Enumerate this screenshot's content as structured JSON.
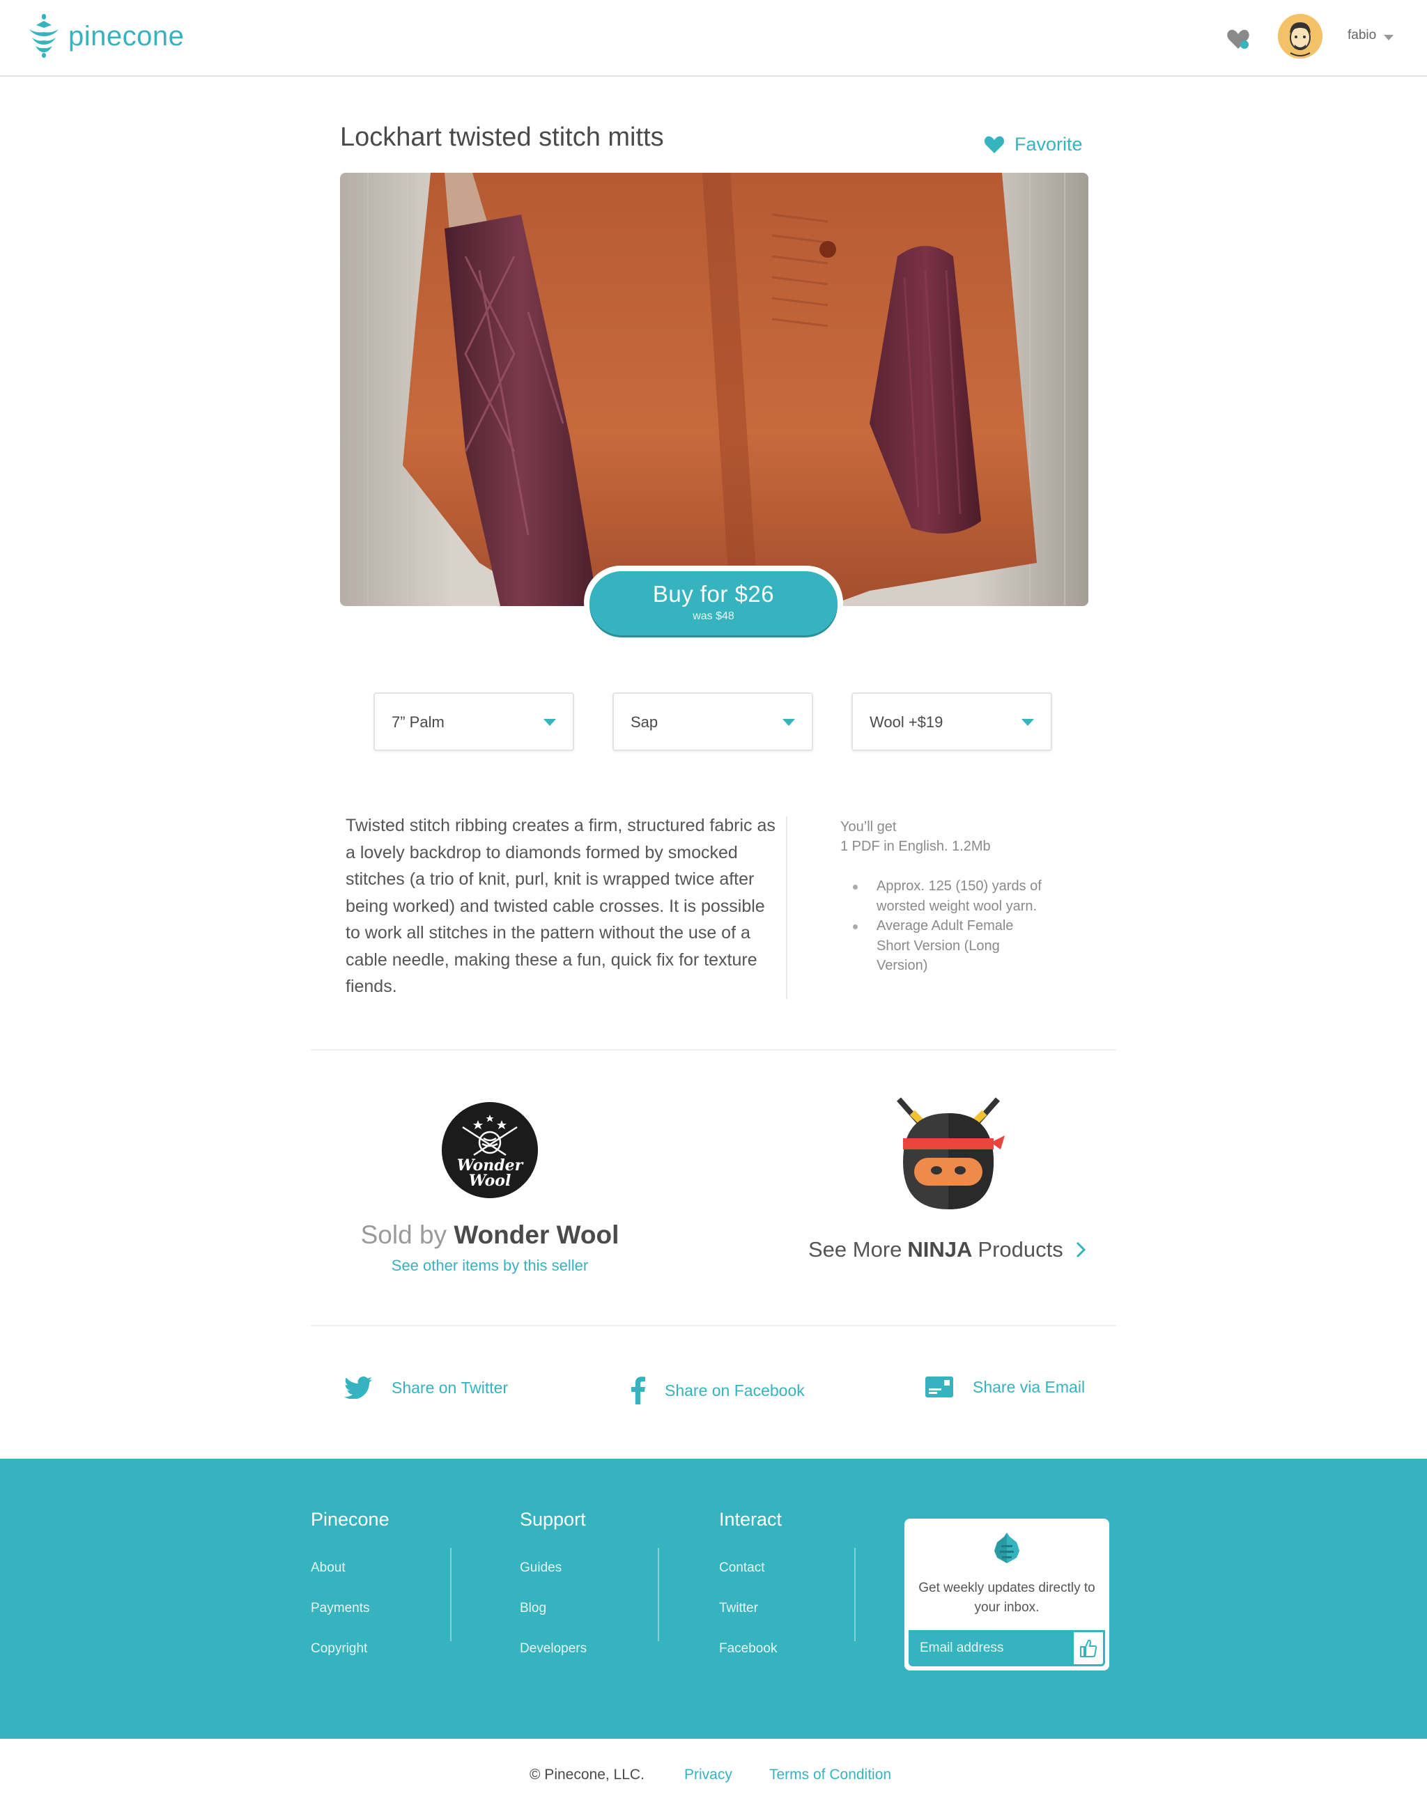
{
  "header": {
    "logo_text": "pinecone",
    "user_name": "fabio"
  },
  "product": {
    "title": "Lockhart twisted stitch mitts",
    "favorite_label": "Favorite",
    "buy_label": "Buy for $26",
    "was_label": "was $48"
  },
  "options": [
    {
      "value": "7” Palm"
    },
    {
      "value": "Sap"
    },
    {
      "value": "Wool  +$19"
    }
  ],
  "description": "Twisted stitch ribbing creates a firm, structured fabric as a lovely backdrop to diamonds formed by smocked stitches (a trio of knit, purl, knit is wrapped twice after being worked) and twisted cable crosses. It is possible to work all stitches in the pattern without the use of a cable needle, making these a fun, quick fix for texture fiends.",
  "you_get": {
    "title": "You’ll get",
    "file": "1 PDF in English. 1.2Mb",
    "items": [
      "Approx. 125 (150) yards of worsted weight wool yarn.",
      "Average Adult Female Short Version (Long Version)"
    ]
  },
  "seller": {
    "logo_line1": "Wonder",
    "logo_line2": "Wool",
    "sold_by_prefix": "Sold by",
    "name": "Wonder Wool",
    "link": "See other items by this seller"
  },
  "more": {
    "prefix": "See More",
    "brand": "NINJA",
    "suffix": "Products"
  },
  "share": {
    "twitter": "Share on Twitter",
    "facebook": "Share on Facebook",
    "email": "Share via Email"
  },
  "footer": {
    "columns": [
      {
        "title": "Pinecone",
        "links": [
          "About",
          "Payments",
          "Copyright"
        ]
      },
      {
        "title": "Support",
        "links": [
          "Guides",
          "Blog",
          "Developers"
        ]
      },
      {
        "title": "Interact",
        "links": [
          "Contact",
          "Twitter",
          "Facebook"
        ]
      }
    ],
    "newsletter": {
      "text": "Get weekly updates directly to your inbox.",
      "placeholder": "Email address"
    }
  },
  "bottom": {
    "copyright": "© Pinecone, LLC.",
    "privacy": "Privacy",
    "terms": "Terms of Condition"
  },
  "colors": {
    "accent": "#35b3bf",
    "text": "#4a4a4a"
  }
}
